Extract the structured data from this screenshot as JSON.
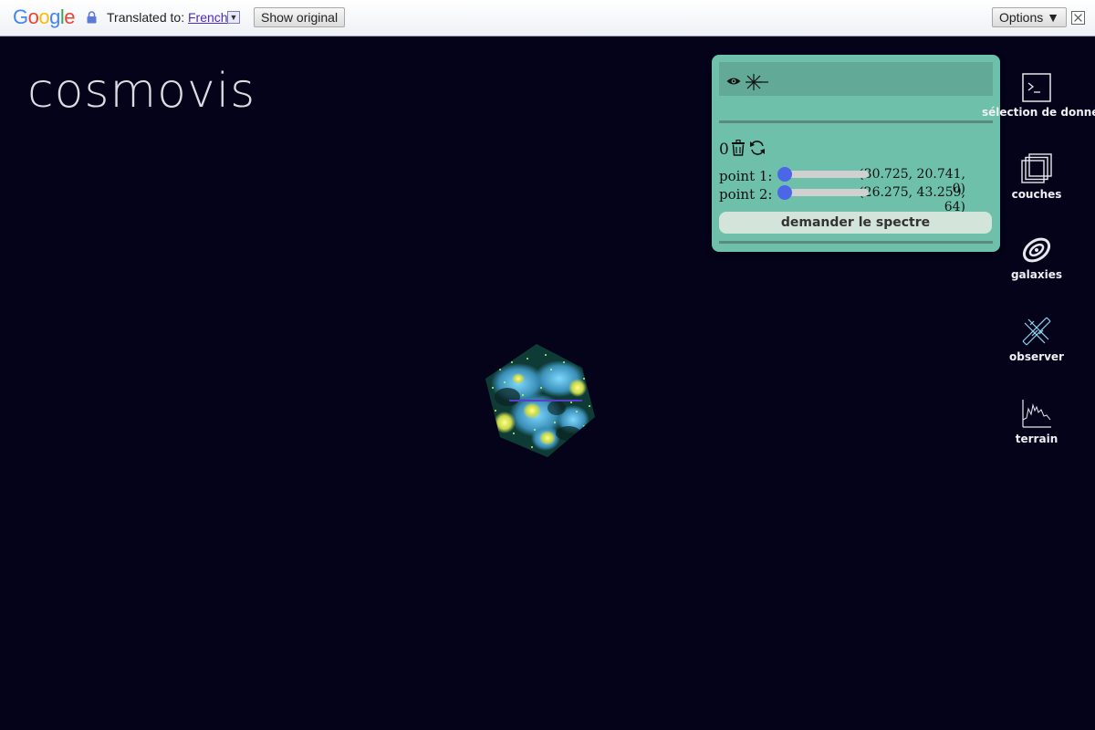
{
  "translate_bar": {
    "logo_letters": [
      "G",
      "o",
      "o",
      "g",
      "l",
      "e"
    ],
    "translated_to": "Translated to:",
    "language": "French",
    "show_original": "Show original",
    "options": "Options ▼"
  },
  "app": {
    "title": "cosmovis"
  },
  "panel": {
    "count": "0",
    "point1": {
      "label": "point 1:",
      "coord": "(30.725, 20.741, 0)",
      "slider_value": 0
    },
    "point2": {
      "label": "point 2:",
      "coord": "(26.275, 43.259, 64)",
      "slider_value": 0
    },
    "spectrum_button": "demander le spectre"
  },
  "nav": {
    "data_selection": "sélection de données",
    "layers": "couches",
    "galaxies": "galaxies",
    "observe": "observer",
    "terrain": "terrain"
  },
  "colors": {
    "background": "#04031a",
    "panel": "#6fc0aa",
    "panel_toolbar": "#62a997",
    "slider_thumb": "#4b66e6",
    "button": "#d3e4da"
  }
}
